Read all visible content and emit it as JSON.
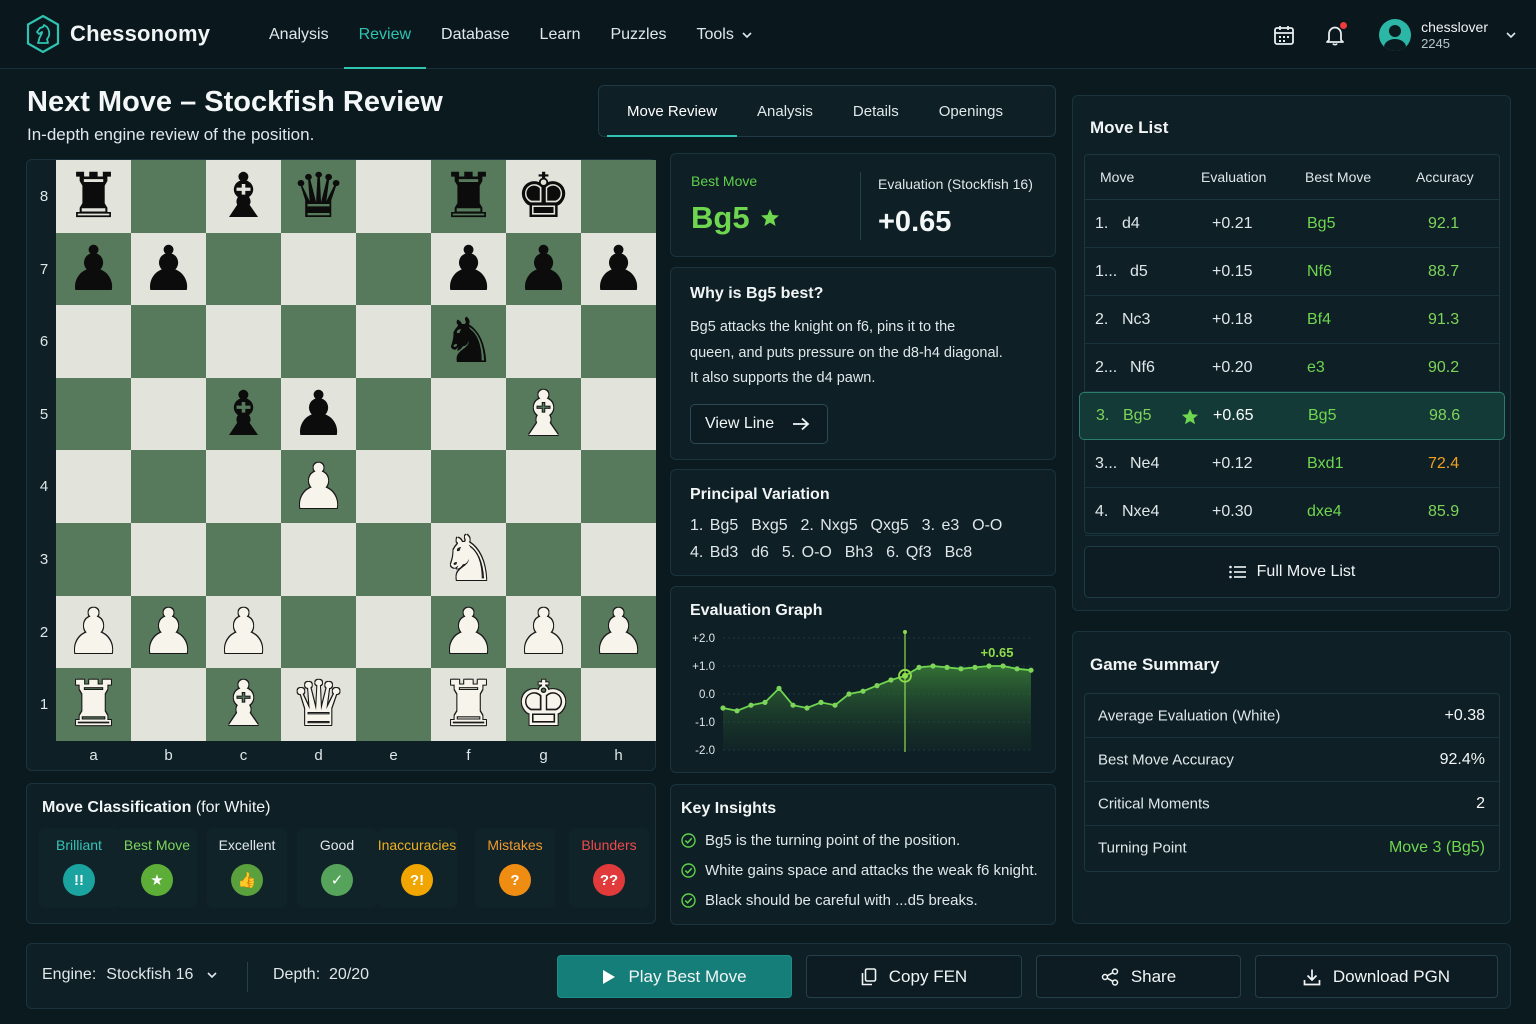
{
  "app": {
    "name": "Chessonomy"
  },
  "nav": {
    "items": [
      "Analysis",
      "Review",
      "Database",
      "Learn",
      "Puzzles"
    ],
    "tools_label": "Tools",
    "active": "Review"
  },
  "user": {
    "name": "chesslover",
    "rating": "2245"
  },
  "header": {
    "title": "Next Move – Stockfish Review",
    "subtitle": "In-depth engine review of the position."
  },
  "tabs": [
    "Move Review",
    "Analysis",
    "Details",
    "Openings"
  ],
  "board": {
    "ranks": [
      "8",
      "7",
      "6",
      "5",
      "4",
      "3",
      "2",
      "1"
    ],
    "files": [
      "a",
      "b",
      "c",
      "d",
      "e",
      "f",
      "g",
      "h"
    ],
    "position": [
      [
        "r",
        "",
        "b",
        "q",
        "",
        "r",
        "k",
        ""
      ],
      [
        "p",
        "p",
        "",
        "",
        "",
        "p",
        "p",
        "p"
      ],
      [
        "",
        "",
        "",
        "",
        "",
        "n",
        "",
        ""
      ],
      [
        "",
        "",
        "b",
        "p",
        "",
        "",
        "B",
        ""
      ],
      [
        "",
        "",
        "",
        "P",
        "",
        "",
        "",
        ""
      ],
      [
        "",
        "",
        "",
        "",
        "",
        "N",
        "",
        ""
      ],
      [
        "P",
        "P",
        "P",
        "",
        "",
        "P",
        "P",
        "P"
      ],
      [
        "R",
        "",
        "B",
        "Q",
        "",
        "R",
        "K",
        ""
      ]
    ]
  },
  "best_move": {
    "label": "Best Move",
    "value": "Bg5"
  },
  "evaluation": {
    "label": "Evaluation (Stockfish 16)",
    "value": "+0.65"
  },
  "why": {
    "title": "Why is Bg5 best?",
    "lines": [
      "Bg5 attacks the knight on f6, pins it to the",
      "queen, and puts pressure on the d8-h4 diagonal.",
      "It also supports the d4 pawn."
    ],
    "button": "View Line"
  },
  "pv": {
    "title": "Principal Variation",
    "line1": "1. Bg5  Bxg5  2. Nxg5  Qxg5  3. e3  O-O",
    "line2": "4. Bd3  d6  5. O-O  Bh3  6. Qf3  Bc8"
  },
  "graph": {
    "title": "Evaluation Graph",
    "y_ticks": [
      "+2.0",
      "+1.0",
      "0.0",
      "-1.0",
      "-2.0"
    ],
    "highlight_label": "+0.65"
  },
  "chart_data": {
    "type": "line",
    "ylim": [
      -2,
      2
    ],
    "highlight_index": 13,
    "values": [
      -0.5,
      -0.6,
      -0.4,
      -0.3,
      0.2,
      -0.4,
      -0.5,
      -0.3,
      -0.4,
      0.0,
      0.1,
      0.3,
      0.5,
      0.65,
      0.95,
      1.0,
      0.95,
      0.9,
      0.95,
      1.0,
      1.0,
      0.9,
      0.85
    ]
  },
  "classification": {
    "title": "Move Classification",
    "suffix": "(for White)",
    "items": [
      {
        "name": "Brilliant",
        "symbol": "!!",
        "color": "#1ba3a0",
        "text_color": "#36c3b8"
      },
      {
        "name": "Best Move",
        "symbol": "★",
        "color": "#5cae38",
        "text_color": "#7ed45a"
      },
      {
        "name": "Excellent",
        "symbol": "👍",
        "color": "#5aa03c",
        "text_color": "#dfe7ea"
      },
      {
        "name": "Good",
        "symbol": "✓",
        "color": "#56a45c",
        "text_color": "#dfe7ea"
      },
      {
        "name": "Inaccuracies",
        "symbol": "?!",
        "color": "#f0a500",
        "text_color": "#f0b020"
      },
      {
        "name": "Mistakes",
        "symbol": "?",
        "color": "#ee8d12",
        "text_color": "#f09a30"
      },
      {
        "name": "Blunders",
        "symbol": "??",
        "color": "#e03a3a",
        "text_color": "#ef4a4a"
      }
    ]
  },
  "insights": {
    "title": "Key Insights",
    "items": [
      "Bg5 is the turning point of the position.",
      "White gains space and attacks the weak f6 knight.",
      "Black should be careful with ...d5 breaks."
    ]
  },
  "move_list": {
    "title": "Move List",
    "headers": [
      "Move",
      "Evaluation",
      "Best Move",
      "Accuracy"
    ],
    "rows": [
      {
        "num": "1.",
        "move": "d4",
        "eval": "+0.21",
        "best": "Bg5",
        "acc": "92.1",
        "acc_color": "#7ed45a"
      },
      {
        "num": "1...",
        "move": "d5",
        "eval": "+0.15",
        "best": "Nf6",
        "acc": "88.7",
        "acc_color": "#7ed45a"
      },
      {
        "num": "2.",
        "move": "Nc3",
        "eval": "+0.18",
        "best": "Bf4",
        "acc": "91.3",
        "acc_color": "#7ed45a"
      },
      {
        "num": "2...",
        "move": "Nf6",
        "eval": "+0.20",
        "best": "e3",
        "acc": "90.2",
        "acc_color": "#7ed45a"
      },
      {
        "num": "3.",
        "move": "Bg5",
        "eval": "+0.65",
        "best": "Bg5",
        "acc": "98.6",
        "acc_color": "#7ed45a"
      },
      {
        "num": "3...",
        "move": "Ne4",
        "eval": "+0.12",
        "best": "Bxd1",
        "acc": "72.4",
        "acc_color": "#f0a020"
      },
      {
        "num": "4.",
        "move": "Nxe4",
        "eval": "+0.30",
        "best": "dxe4",
        "acc": "85.9",
        "acc_color": "#7ed45a"
      }
    ],
    "full_button": "Full Move List"
  },
  "summary": {
    "title": "Game Summary",
    "rows": [
      {
        "label": "Average Evaluation (White)",
        "value": "+0.38"
      },
      {
        "label": "Best Move Accuracy",
        "value": "92.4%"
      },
      {
        "label": "Critical Moments",
        "value": "2"
      },
      {
        "label": "Turning Point",
        "value": "Move 3 (Bg5)"
      }
    ]
  },
  "bottom": {
    "engine_label": "Engine:",
    "engine_value": "Stockfish 16",
    "depth_label": "Depth:",
    "depth_value": "20/20",
    "play": "Play Best Move",
    "copy": "Copy FEN",
    "share": "Share",
    "download": "Download PGN"
  },
  "colors": {
    "accent": "#2fc3b2",
    "best": "#6fd64f",
    "board_light": "#e2e3da",
    "board_dark": "#587a5c"
  }
}
